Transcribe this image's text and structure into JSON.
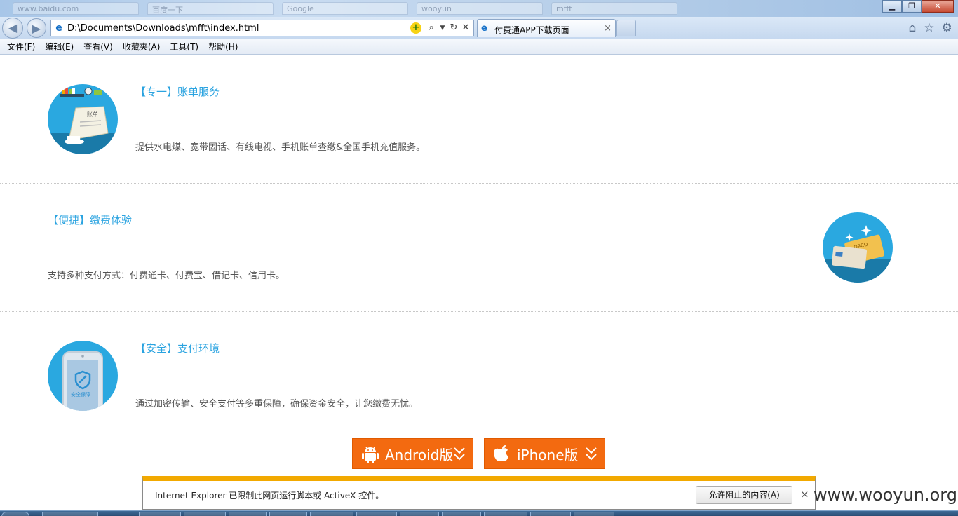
{
  "window": {
    "ghost_tabs": [
      "www.baidu.com",
      "百度一下",
      "Google",
      "wooyun",
      "mfft"
    ]
  },
  "nav": {
    "back_label": "back",
    "forward_label": "forward",
    "address": "D:\\Documents\\Downloads\\mfft\\index.html"
  },
  "tab": {
    "title": "付费通APP下载页面",
    "close": "×"
  },
  "menu": [
    "文件(F)",
    "编辑(E)",
    "查看(V)",
    "收藏夹(A)",
    "工具(T)",
    "帮助(H)"
  ],
  "features": [
    {
      "title": "【专一】账单服务",
      "desc": "提供水电煤、宽带固话、有线电视、手机账单查缴&全国手机充值服务。"
    },
    {
      "title": "【便捷】缴费体验",
      "desc": "支持多种支付方式：付费通卡、付费宝、借记卡、信用卡。"
    },
    {
      "title": "【安全】支付环境",
      "desc": "通过加密传输、安全支付等多重保障，确保资金安全，让您缴费无忧。"
    }
  ],
  "illustrations": {
    "bill_text": "账单",
    "card_text": "ORCO",
    "phone_text": "安全保障"
  },
  "downloads": {
    "android": "Android版",
    "iphone": "iPhone版"
  },
  "notification": {
    "message": "Internet Explorer 已限制此网页运行脚本或 ActiveX 控件。",
    "button": "允许阻止的内容(A)",
    "close": "×"
  },
  "watermark": "www.wooyun.org",
  "colors": {
    "accent_blue": "#2aa3e0",
    "download_orange": "#f36a10",
    "notify_bar": "#f2a900"
  }
}
